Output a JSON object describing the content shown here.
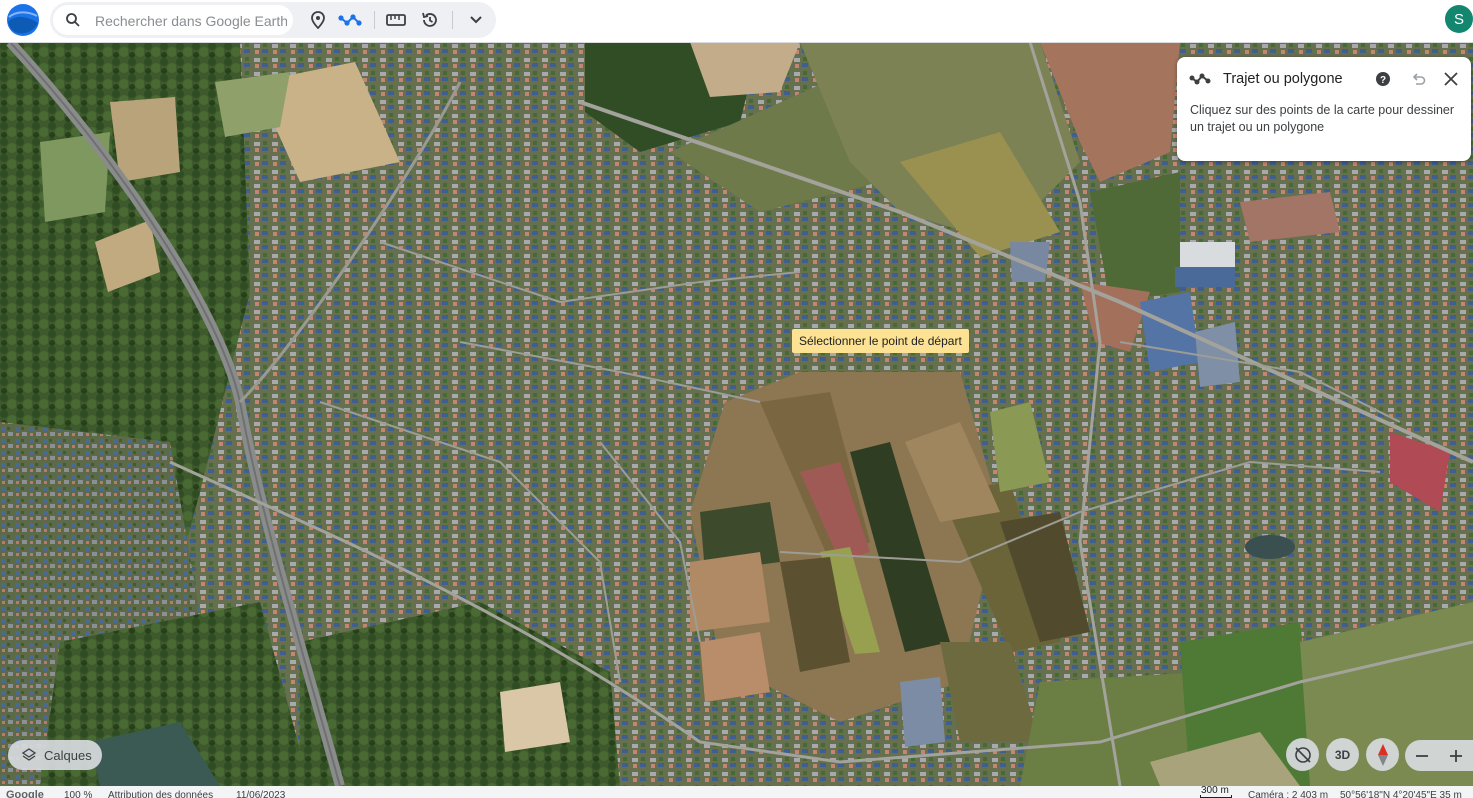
{
  "app": {
    "avatar_letter": "S",
    "brand_color": "#1a73e8"
  },
  "search": {
    "placeholder": "Rechercher dans Google Earth",
    "icon": "search-icon"
  },
  "toolbar": {
    "icons": [
      "location-pin-icon",
      "path-polygon-icon",
      "ruler-icon",
      "history-icon",
      "chevron-down-icon"
    ],
    "active_color": "#1a73e8"
  },
  "panel": {
    "title": "Trajet ou polygone",
    "description": "Cliquez sur des points de la carte pour dessiner un trajet ou un polygone",
    "icons": [
      "path-polygon-icon",
      "help-icon",
      "undo-icon",
      "close-icon"
    ]
  },
  "tooltip": {
    "text": "Sélectionner le point de départ",
    "color": "#fde293"
  },
  "controls": {
    "layers_label": "Calques",
    "btn_3d_label": "3D",
    "icons": [
      "layers-icon",
      "tilt-reset-icon",
      "compass-icon",
      "zoom-out-icon",
      "zoom-in-icon"
    ]
  },
  "status": {
    "google": "Google",
    "zoom": "100 %",
    "attribution": "Attribution des données",
    "date": "11/06/2023",
    "scale": "300 m",
    "camera": "Caméra : 2 403 m",
    "coords": "50°56'18\"N 4°20'45\"E  35 m"
  }
}
